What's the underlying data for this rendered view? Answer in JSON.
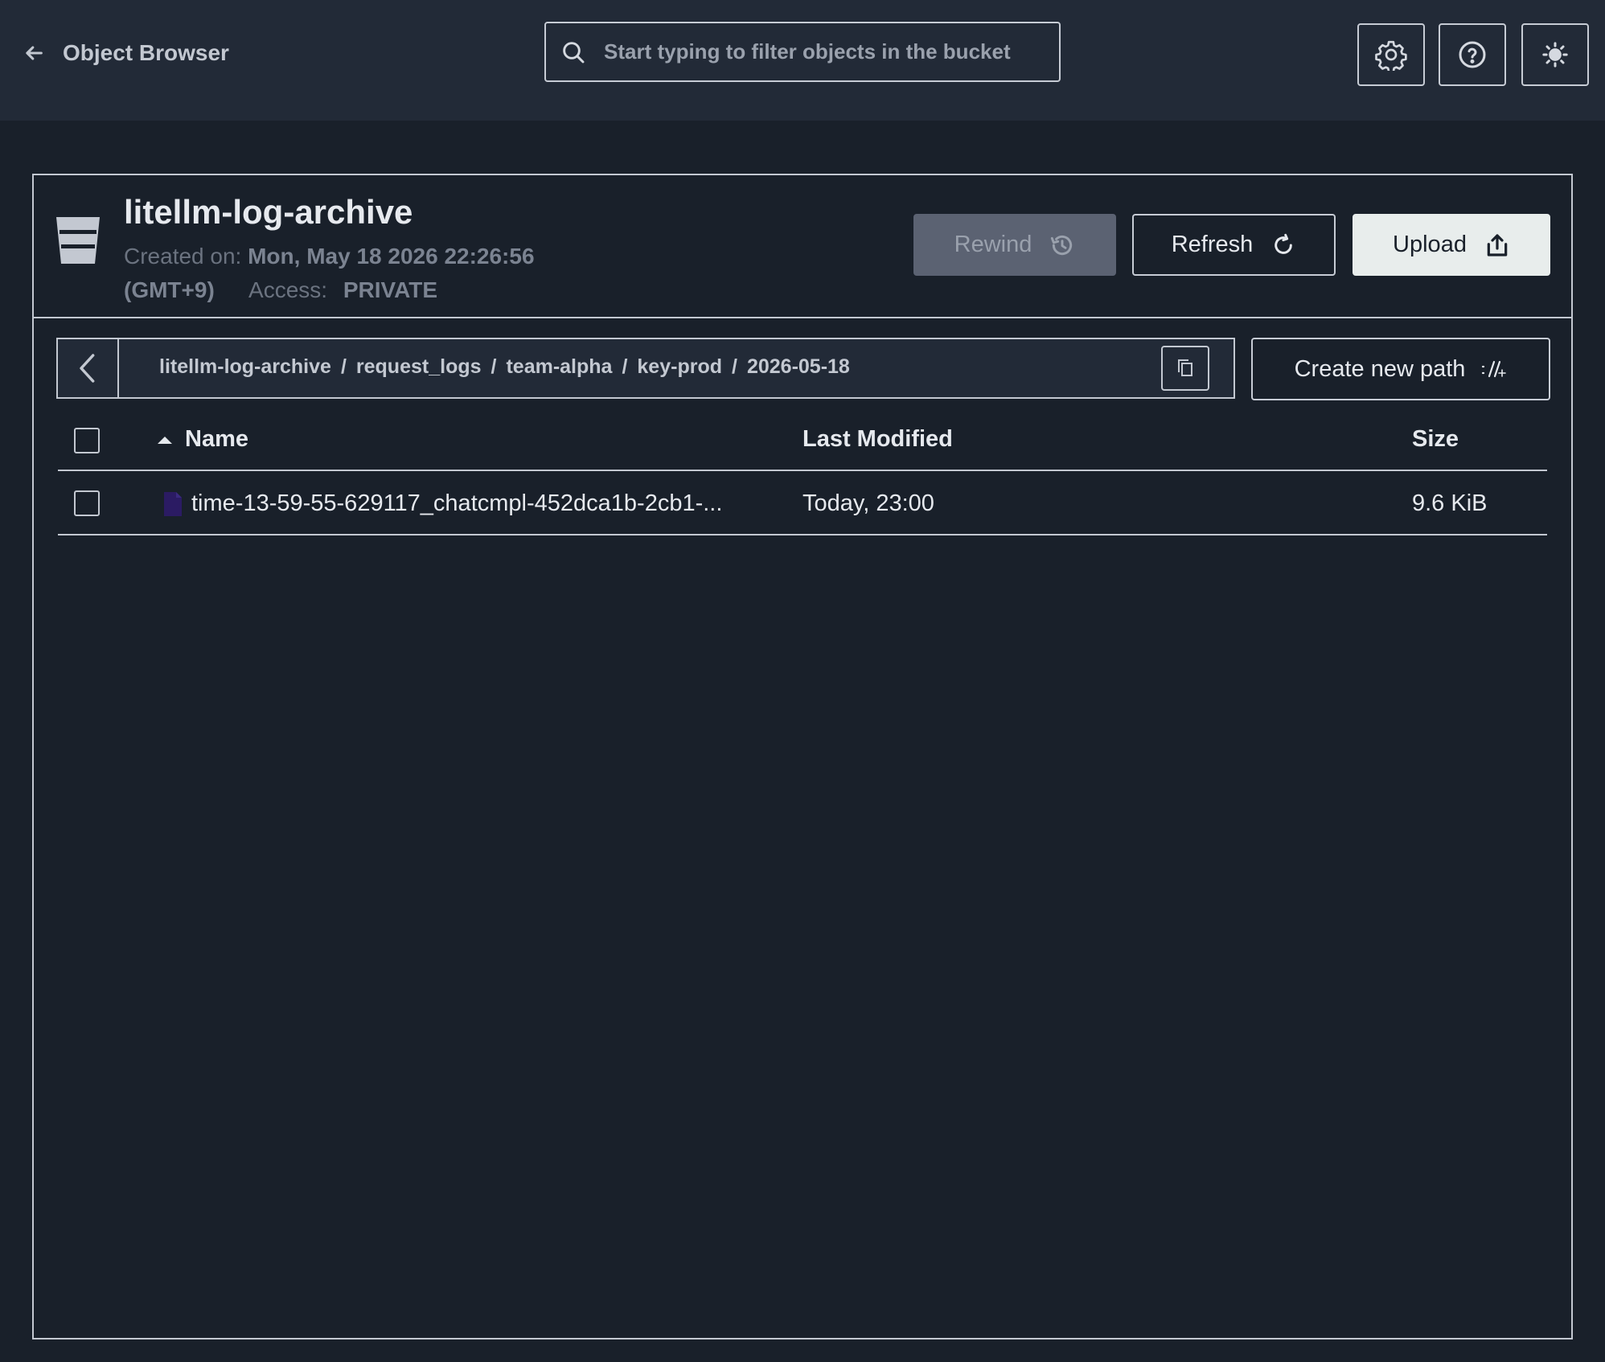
{
  "header": {
    "back_label": "Object Browser",
    "search_placeholder": "Start typing to filter objects in the bucket"
  },
  "bucket": {
    "name": "litellm-log-archive",
    "created_label": "Created on:",
    "created_value": "Mon, May 18 2026 22:26:56",
    "timezone": "(GMT+9)",
    "access_label": "Access:",
    "access_value": "PRIVATE"
  },
  "actions": {
    "rewind": "Rewind",
    "refresh": "Refresh",
    "upload": "Upload",
    "create_path": "Create new path"
  },
  "path": {
    "segments": [
      "litellm-log-archive",
      "request_logs",
      "team-alpha",
      "key-prod",
      "2026-05-18"
    ],
    "separator": "/"
  },
  "table": {
    "columns": {
      "name": "Name",
      "modified": "Last Modified",
      "size": "Size"
    },
    "rows": [
      {
        "name": "time-13-59-55-629117_chatcmpl-452dca1b-2cb1-...",
        "modified": "Today, 23:00",
        "size": "9.6 KiB"
      }
    ]
  },
  "colors": {
    "background": "#19202a",
    "topbar": "#222a37",
    "upload_button": "#e8edec",
    "rewind_disabled": "#5b6272",
    "file_icon": "#2b1b63"
  }
}
